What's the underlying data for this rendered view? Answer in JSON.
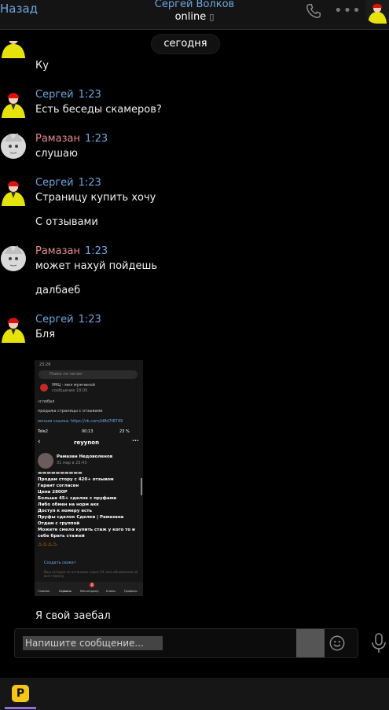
{
  "header": {
    "back_label": "Назад",
    "contact_name": "Сергей Волков",
    "status": "online",
    "status_icon": "phone-glyph"
  },
  "date_separator": "сегодня",
  "messages": [
    {
      "author": "",
      "time": "",
      "texts": [
        "Ку"
      ]
    },
    {
      "author": "Сергей",
      "time": "1:23",
      "texts": [
        "Есть беседы скамеров?"
      ]
    },
    {
      "author": "Рамазан",
      "time": "1:23",
      "texts": [
        "слушаю"
      ]
    },
    {
      "author": "Сергей",
      "time": "1:23",
      "texts": [
        "Страницу купить хочу",
        "С отзывами"
      ]
    },
    {
      "author": "Рамазан",
      "time": "1:23",
      "texts": [
        "может нахуй пойдешь",
        "далбаеб"
      ]
    },
    {
      "author": "Сергей",
      "time": "1:23",
      "texts": [
        "Бля",
        "Я свой заебал"
      ]
    }
  ],
  "attachment": {
    "status_time": "23:26",
    "search_placeholder": "Поиск по чатам",
    "chat_title": "УМЦ - мел мужчиной",
    "chat_sub": "сообщение 18:00",
    "line1": "«глобал",
    "line2": "продажа страницы с отзывами",
    "line3": "вечная ссылка: https://vk.com/id8d7f8749",
    "status_carrier": "Tele2",
    "status_time2": "00:13",
    "battery": "23 %",
    "profile_handle": "reyynon",
    "post_author": "Рамазан Недоволенов",
    "post_time": "31 мар в 23:43",
    "post_lines": [
      "Продам стору с 420+ отзывом",
      "Гарант согласен",
      "Цена 2800Р",
      "Больше 45+ сделок с пруфами",
      "Либо обмен на норм акк",
      "Доступ к номеру есть",
      "Пруфы сделок Сделки | Рамазана",
      "Отдам с группой",
      "Можете смело купить стаж у кого то и",
      "себе брать стажей"
    ],
    "create_story": "Создать сюжет",
    "story_note": "Ваш история не остановка через 24 часа обновления на все сторону",
    "nav": [
      "Главная",
      "Сервисы",
      "Мессенджер",
      "Клипы",
      "Профиль"
    ],
    "nav_badge": "2"
  },
  "composer": {
    "placeholder": "Напишите сообщение..."
  },
  "bottom_bar": {
    "app_icon_glyph": "P"
  },
  "colors": {
    "accent_blue": "#6ea6e0",
    "accent_pink": "#e38b94",
    "background": "#000000",
    "header_bg": "#141414"
  }
}
